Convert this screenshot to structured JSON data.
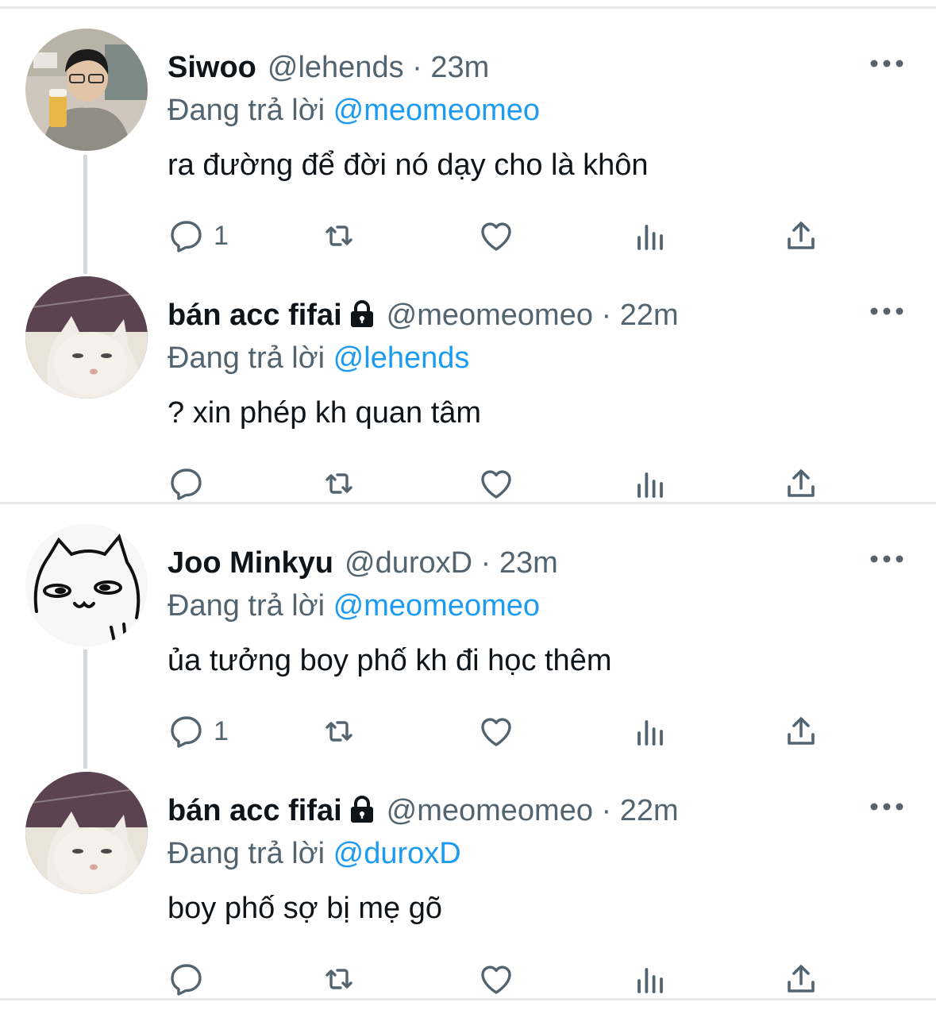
{
  "tweets": [
    {
      "name": "Siwoo",
      "locked": false,
      "handle": "@lehends",
      "separator": "·",
      "time": "23m",
      "reply_prefix": "Đang trả lời",
      "reply_to": "@meomeomeo",
      "text": "ra đường để đời nó dạy cho là khôn",
      "reply_count": "1",
      "avatar": "person-with-beer"
    },
    {
      "name": "bán acc fifai",
      "locked": true,
      "handle": "@meomeomeo",
      "separator": "·",
      "time": "22m",
      "reply_prefix": "Đang trả lời",
      "reply_to": "@lehends",
      "text": "? xin phép kh quan tâm",
      "reply_count": "",
      "avatar": "white-cat-photo"
    },
    {
      "name": "Joo Minkyu",
      "locked": false,
      "handle": "@duroxD",
      "separator": "·",
      "time": "23m",
      "reply_prefix": "Đang trả lời",
      "reply_to": "@meomeomeo",
      "text": "ủa tưởng boy phố kh đi học thêm",
      "reply_count": "1",
      "avatar": "cat-doodle"
    },
    {
      "name": "bán acc fifai",
      "locked": true,
      "handle": "@meomeomeo",
      "separator": "·",
      "time": "22m",
      "reply_prefix": "Đang trả lời",
      "reply_to": "@duroxD",
      "text": "boy phố sợ bị mẹ gõ",
      "reply_count": "",
      "avatar": "white-cat-photo"
    }
  ],
  "icons": {
    "reply": "reply-icon",
    "retweet": "retweet-icon",
    "like": "like-icon",
    "views": "views-icon",
    "share": "share-icon",
    "more": "more-icon",
    "lock": "lock-icon"
  },
  "colors": {
    "text": "#0f1419",
    "secondary": "#536471",
    "link": "#1d9bf0",
    "divider": "#e7e9eb",
    "thread_line": "#d3d9dd"
  }
}
